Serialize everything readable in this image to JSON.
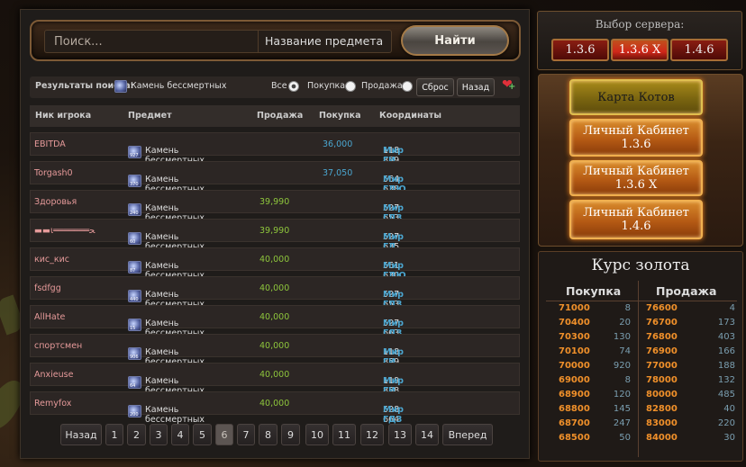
{
  "search": {
    "placeholder": "Поиск...",
    "item_name_label": "Название предмета",
    "find_button": "Найти"
  },
  "results_bar": {
    "label": "Результаты поиска:",
    "item": "Камень бессмертных",
    "filter_all": "Все",
    "filter_buy": "Покупка",
    "filter_sell": "Продажа",
    "selected_filter": "Все",
    "reset_button": "Сброс",
    "back_button": "Назад"
  },
  "table": {
    "headers": [
      "Ник игрока",
      "Предмет",
      "Продажа",
      "Покупка",
      "Координаты"
    ],
    "rows": [
      {
        "nick": "EBITDA",
        "item": "Камень бессмертных",
        "gem_qty": "927",
        "sale": "",
        "buy": "36,000",
        "coords": "118 859",
        "world": "Мир ГИ"
      },
      {
        "nick": "Torgash0",
        "item": "Камень бессмертных",
        "gem_qty": "370",
        "sale": "",
        "buy": "37,050",
        "coords": "564 638",
        "world": "Мир ГДЮ"
      },
      {
        "nick": "Здоровья",
        "item": "Камень бессмертных",
        "gem_qty": "240",
        "sale": "39,990",
        "buy": "",
        "coords": "527 653",
        "world": "Мир ГДЗ"
      },
      {
        "nick": "▬▬ι═══════ﺤ",
        "item": "Камень бессмертных",
        "gem_qty": "60",
        "sale": "39,990",
        "buy": "",
        "coords": "527 635",
        "world": "Мир ГД Печки"
      },
      {
        "nick": "кис_кис",
        "item": "Камень бессмертных",
        "gem_qty": "87",
        "sale": "40,000",
        "buy": "",
        "coords": "561 630",
        "world": "Мир ГДЮ"
      },
      {
        "nick": "fsdfgg",
        "item": "Камень бессмертных",
        "gem_qty": "440",
        "sale": "40,000",
        "buy": "",
        "coords": "527 653",
        "world": "Мир ГДЗ"
      },
      {
        "nick": "AllHate",
        "item": "Камень бессмертных",
        "gem_qty": "15",
        "sale": "40,000",
        "buy": "",
        "coords": "527 663",
        "world": "Мир ГДЗ"
      },
      {
        "nick": "спортсмен",
        "item": "Камень бессмертных",
        "gem_qty": "906",
        "sale": "40,000",
        "buy": "",
        "coords": "118 859",
        "world": "Мир ГИ"
      },
      {
        "nick": "Anxieuse",
        "item": "Камень бессмертных",
        "gem_qty": "64",
        "sale": "40,000",
        "buy": "",
        "coords": "119 858",
        "world": "Мир ГИ"
      },
      {
        "nick": "Remyfox",
        "item": "Камень бессмертных",
        "gem_qty": "200",
        "sale": "40,000",
        "buy": "",
        "coords": "528 664",
        "world": "Мир ГДЗ"
      }
    ]
  },
  "pagination": {
    "prev": "Назад",
    "pages": [
      "1",
      "2",
      "3",
      "4",
      "5",
      "6",
      "7",
      "8",
      "9",
      "10",
      "11",
      "12",
      "13",
      "14"
    ],
    "current": "6",
    "next": "Вперед"
  },
  "server": {
    "title": "Выбор сервера:",
    "options": [
      "1.3.6",
      "1.3.6 X",
      "1.4.6"
    ],
    "selected": "1.3.6 X"
  },
  "cabinet": {
    "cats_map": "Карта Котов",
    "buttons": [
      {
        "line1": "Личный Кабинет",
        "line2": "1.3.6"
      },
      {
        "line1": "Личный Кабинет",
        "line2": "1.3.6 X"
      },
      {
        "line1": "Личный Кабинет",
        "line2": "1.4.6"
      }
    ]
  },
  "gold": {
    "title": "Курс золота",
    "buy_header": "Покупка",
    "sell_header": "Продажа",
    "rows": [
      {
        "buy_price": "71000",
        "buy_qty": "8",
        "sell_price": "76600",
        "sell_qty": "4"
      },
      {
        "buy_price": "70400",
        "buy_qty": "20",
        "sell_price": "76700",
        "sell_qty": "173"
      },
      {
        "buy_price": "70300",
        "buy_qty": "130",
        "sell_price": "76800",
        "sell_qty": "403"
      },
      {
        "buy_price": "70100",
        "buy_qty": "74",
        "sell_price": "76900",
        "sell_qty": "166"
      },
      {
        "buy_price": "70000",
        "buy_qty": "920",
        "sell_price": "77000",
        "sell_qty": "188"
      },
      {
        "buy_price": "69000",
        "buy_qty": "8",
        "sell_price": "78000",
        "sell_qty": "132"
      },
      {
        "buy_price": "68900",
        "buy_qty": "120",
        "sell_price": "80000",
        "sell_qty": "485"
      },
      {
        "buy_price": "68800",
        "buy_qty": "145",
        "sell_price": "82800",
        "sell_qty": "40"
      },
      {
        "buy_price": "68700",
        "buy_qty": "247",
        "sell_price": "83000",
        "sell_qty": "220"
      },
      {
        "buy_price": "68500",
        "buy_qty": "50",
        "sell_price": "84000",
        "sell_qty": "30"
      }
    ]
  },
  "colors": {
    "accent_orange": "#f0902a",
    "buy_blue": "#4ba6d0",
    "sale_green": "#8ec63c",
    "nick_pink": "#e69a9a"
  }
}
